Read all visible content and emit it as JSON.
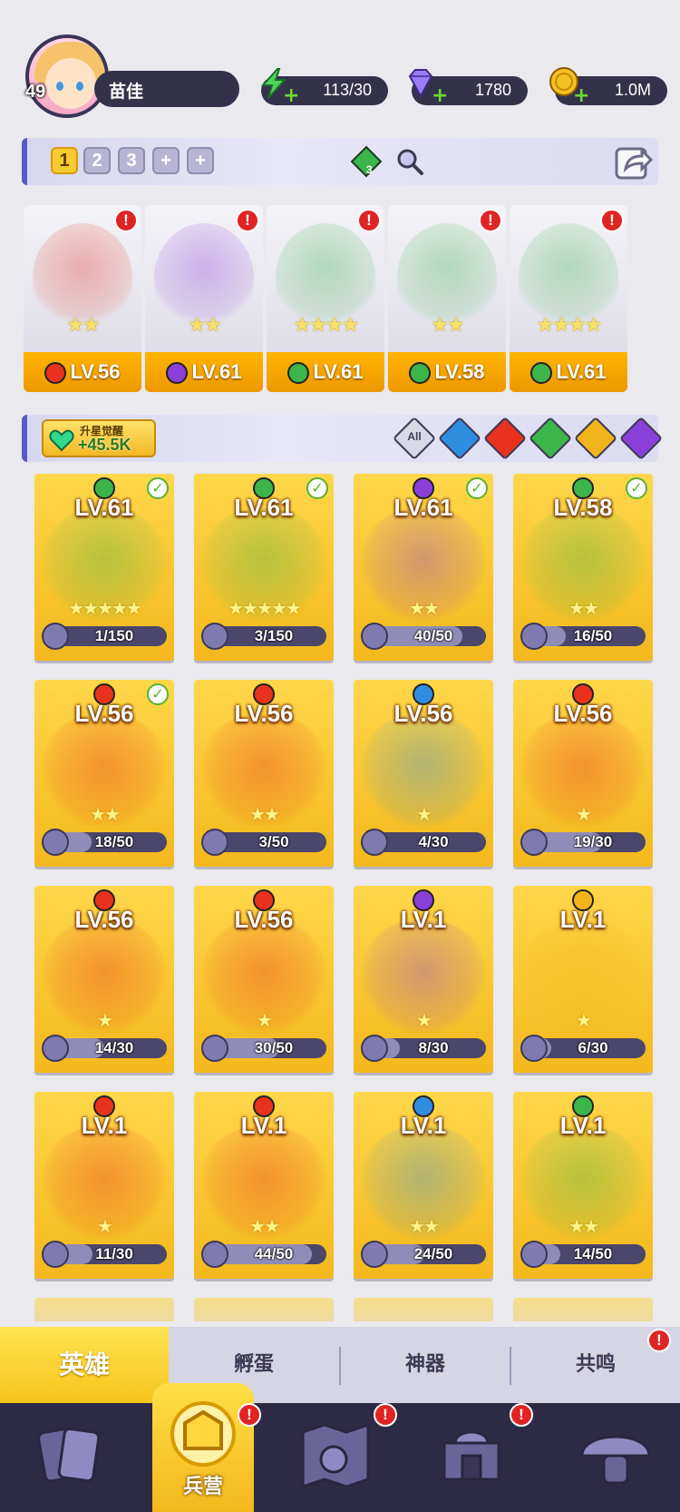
{
  "player": {
    "name": "苗佳",
    "level": "49"
  },
  "resources": [
    {
      "name": "energy",
      "icon": "lightning-icon",
      "value": "113/30",
      "color": "#4fd35a"
    },
    {
      "name": "gems",
      "icon": "diamond-icon",
      "value": "1780",
      "color": "#9b7cf5"
    },
    {
      "name": "coins",
      "icon": "coin-icon",
      "value": "1.0M",
      "color": "#f5c022"
    }
  ],
  "team_tabs": [
    "1",
    "2",
    "3",
    "+",
    "+"
  ],
  "team_badge": "3",
  "squad": [
    {
      "level": "LV.56",
      "element": "fire",
      "stars": "★★",
      "alert": "!"
    },
    {
      "level": "LV.61",
      "element": "dark",
      "stars": "★★",
      "alert": "!"
    },
    {
      "level": "LV.61",
      "element": "wind",
      "stars": "★★★★",
      "alert": "!"
    },
    {
      "level": "LV.58",
      "element": "wind",
      "stars": "★★",
      "alert": "!"
    },
    {
      "level": "LV.61",
      "element": "wind",
      "stars": "★★★★",
      "alert": "!"
    }
  ],
  "awaken": {
    "title": "升星觉醒",
    "value": "+45.5K"
  },
  "filters": [
    "All",
    "water",
    "fire",
    "wind",
    "light",
    "dark"
  ],
  "filter_all_label": "All",
  "heroes": [
    {
      "level": "LV.61",
      "element": "wind",
      "stars": "★★★★★",
      "shards": "1/150",
      "check": true,
      "progress": 0.01
    },
    {
      "level": "LV.61",
      "element": "wind",
      "stars": "★★★★★",
      "shards": "3/150",
      "check": true,
      "progress": 0.02
    },
    {
      "level": "LV.61",
      "element": "dark",
      "stars": "★★",
      "shards": "40/50",
      "check": true,
      "progress": 0.8
    },
    {
      "level": "LV.58",
      "element": "wind",
      "stars": "★★",
      "shards": "16/50",
      "check": true,
      "progress": 0.32
    },
    {
      "level": "LV.56",
      "element": "fire",
      "stars": "★★",
      "shards": "18/50",
      "check": true,
      "progress": 0.36
    },
    {
      "level": "LV.56",
      "element": "fire",
      "stars": "★★",
      "shards": "3/50",
      "check": false,
      "progress": 0.06
    },
    {
      "level": "LV.56",
      "element": "water",
      "stars": "★",
      "shards": "4/30",
      "check": false,
      "progress": 0.13
    },
    {
      "level": "LV.56",
      "element": "fire",
      "stars": "★",
      "shards": "19/30",
      "check": false,
      "progress": 0.63
    },
    {
      "level": "LV.56",
      "element": "fire",
      "stars": "★",
      "shards": "14/30",
      "check": false,
      "progress": 0.47
    },
    {
      "level": "LV.56",
      "element": "fire",
      "stars": "★",
      "shards": "30/50",
      "check": false,
      "progress": 0.6
    },
    {
      "level": "LV.1",
      "element": "dark",
      "stars": "★",
      "shards": "8/30",
      "check": false,
      "progress": 0.27
    },
    {
      "level": "LV.1",
      "element": "light",
      "stars": "★",
      "shards": "6/30",
      "check": false,
      "progress": 0.2
    },
    {
      "level": "LV.1",
      "element": "fire",
      "stars": "★",
      "shards": "11/30",
      "check": false,
      "progress": 0.37
    },
    {
      "level": "LV.1",
      "element": "fire",
      "stars": "★★",
      "shards": "44/50",
      "check": false,
      "progress": 0.88
    },
    {
      "level": "LV.1",
      "element": "water",
      "stars": "★★",
      "shards": "24/50",
      "check": false,
      "progress": 0.48
    },
    {
      "level": "LV.1",
      "element": "wind",
      "stars": "★★",
      "shards": "14/50",
      "check": false,
      "progress": 0.28
    }
  ],
  "element_colors": {
    "fire": "#e8321d",
    "water": "#2f8de0",
    "wind": "#3cb54a",
    "dark": "#8a3fd8",
    "light": "#f1b51b"
  },
  "bottom_tabs": [
    {
      "label": "英雄",
      "active": true
    },
    {
      "label": "孵蛋",
      "active": false
    },
    {
      "label": "神器",
      "active": false
    },
    {
      "label": "共鸣",
      "active": false,
      "alert": "!"
    }
  ],
  "nav": [
    {
      "icon": "cards-icon",
      "label": ""
    },
    {
      "icon": "barracks-icon",
      "label": "兵营",
      "active": true,
      "alert": "!"
    },
    {
      "icon": "map-icon",
      "label": "",
      "alert": "!"
    },
    {
      "icon": "temple-icon",
      "label": "",
      "alert": "!"
    },
    {
      "icon": "mushroom-icon",
      "label": ""
    }
  ]
}
